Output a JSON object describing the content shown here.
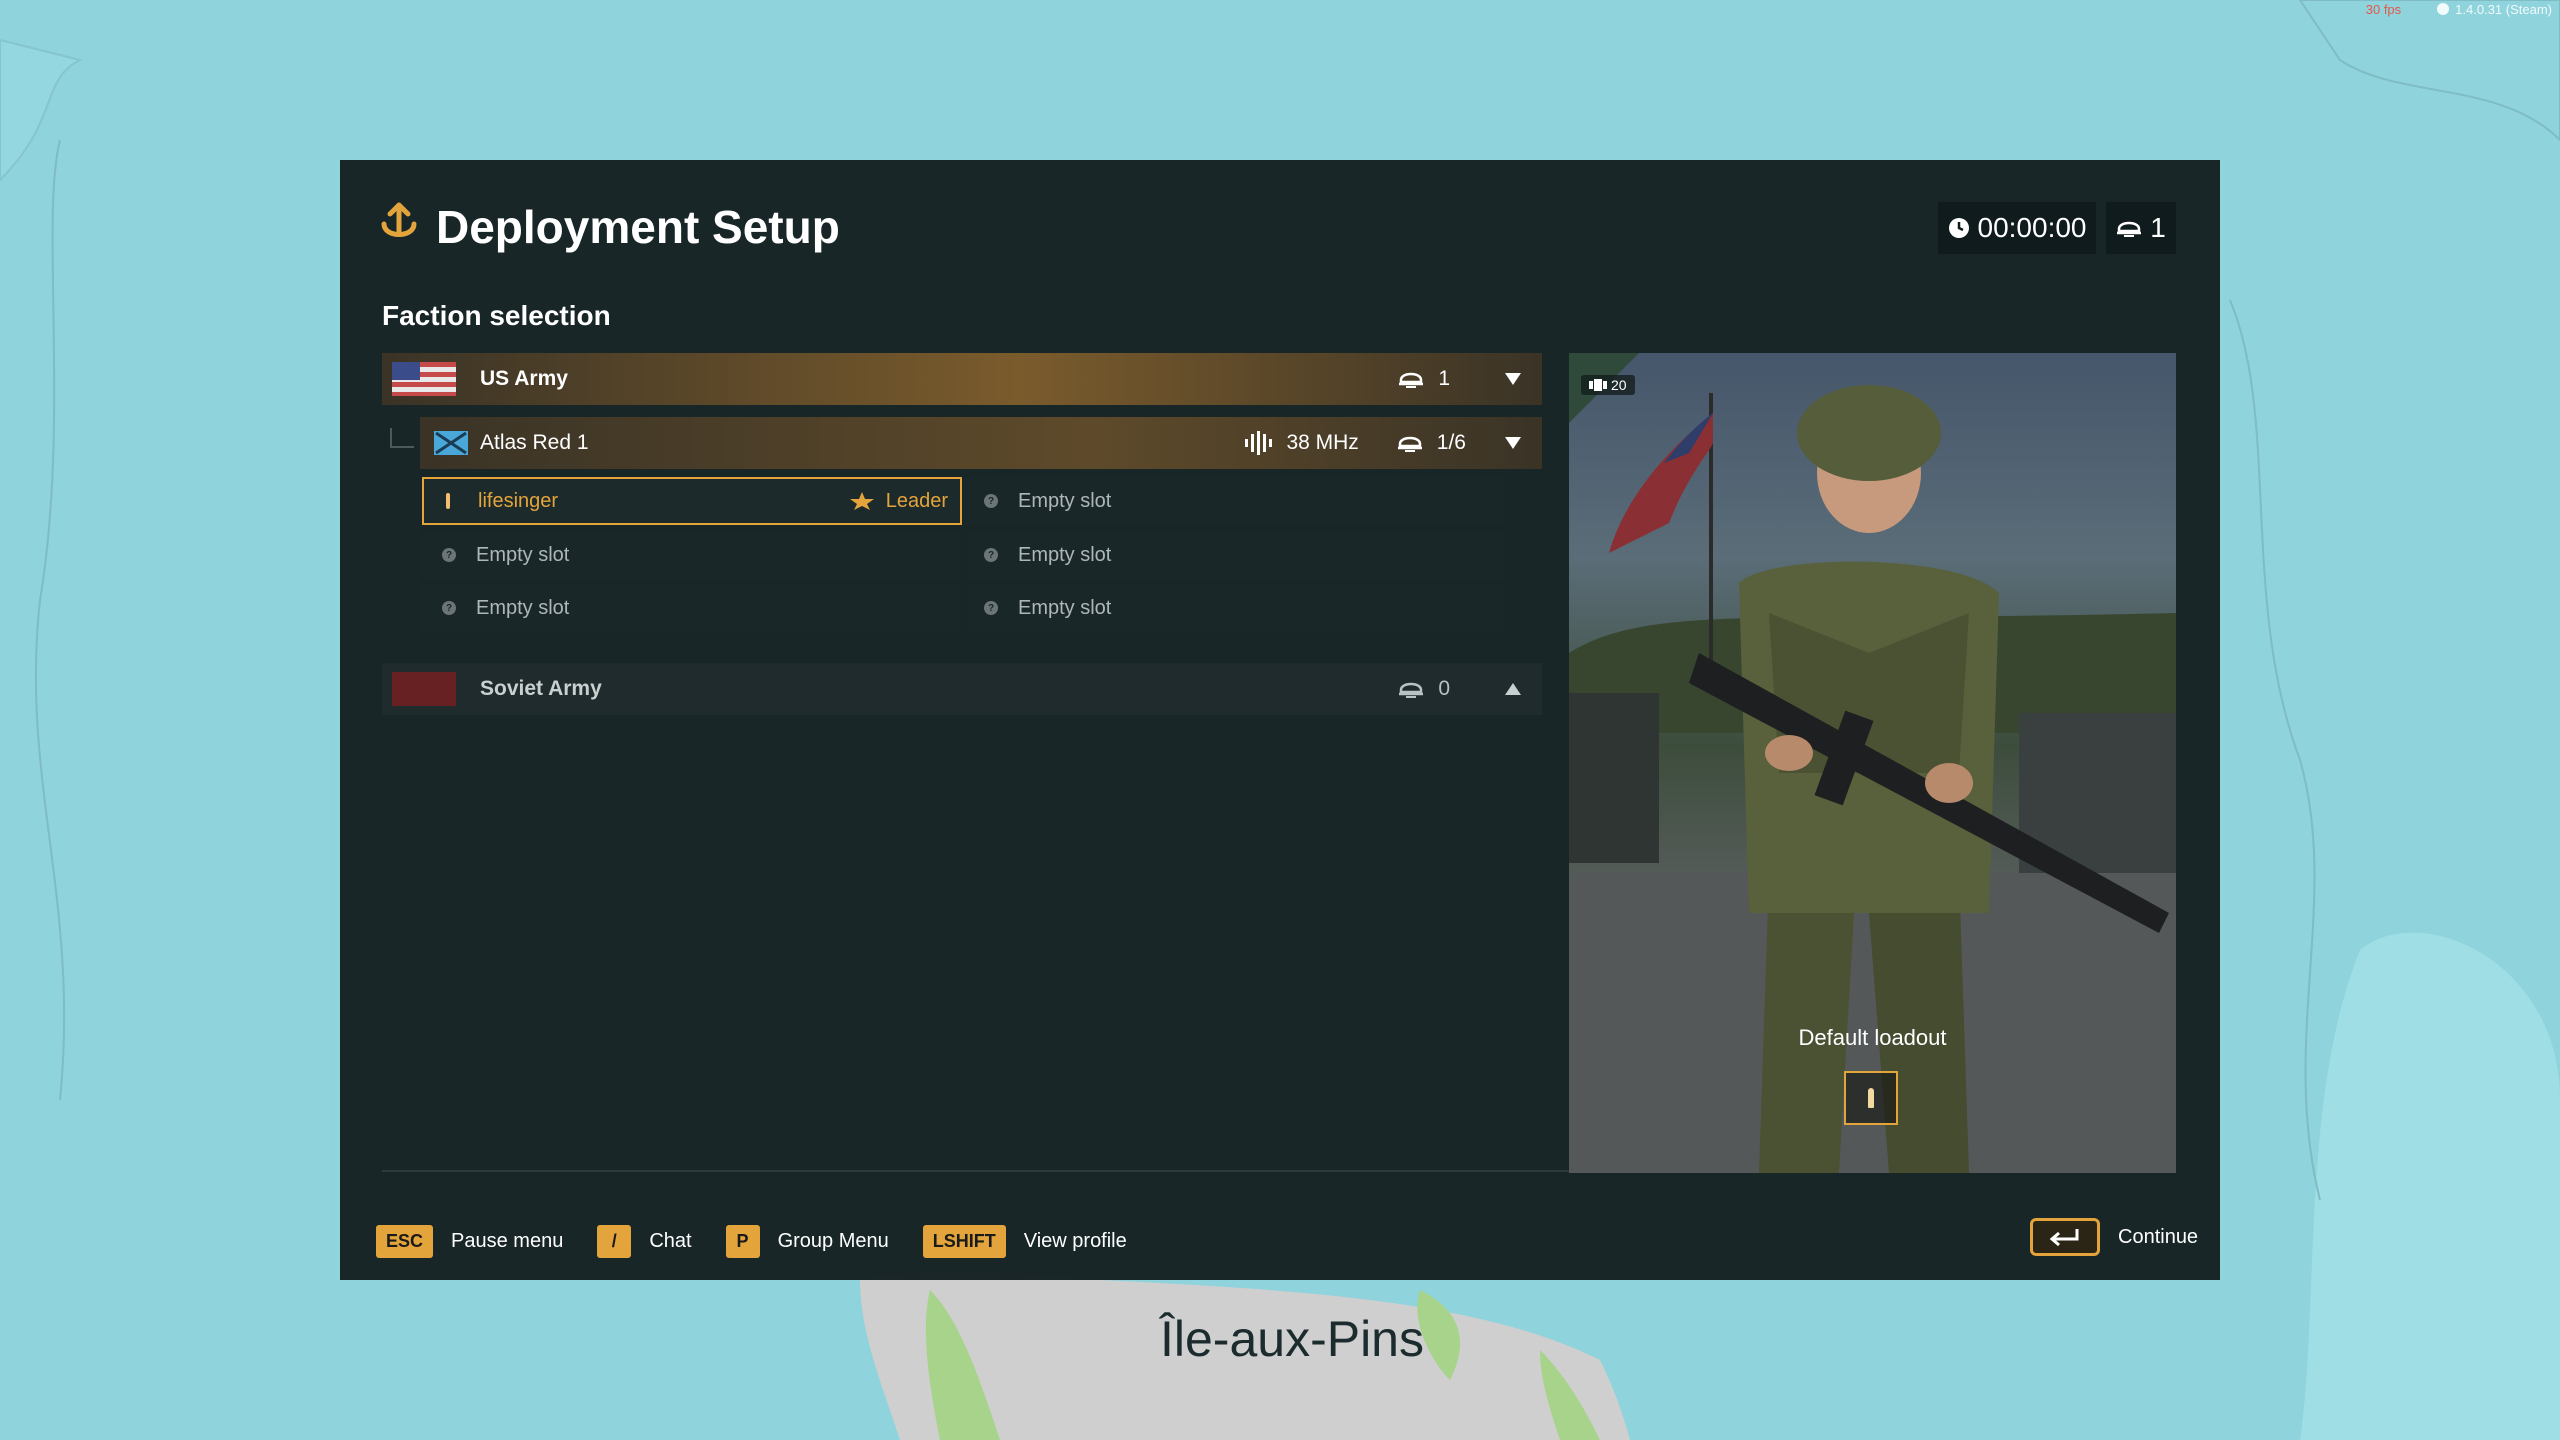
{
  "map": {
    "label": "Île-aux-Pins"
  },
  "status": {
    "fps": "30 fps",
    "version": "1.4.0.31 (Steam)"
  },
  "header": {
    "title": "Deployment Setup",
    "timer": "00:00:00",
    "player_count": "1"
  },
  "faction_section": {
    "title": "Faction selection",
    "factions": [
      {
        "name": "US Army",
        "players": "1"
      },
      {
        "name": "Soviet Army",
        "players": "0"
      }
    ],
    "group": {
      "name": "Atlas Red 1",
      "frequency": "38 MHz",
      "slots_filled": "1/6",
      "slots": [
        {
          "name": "lifesinger",
          "role": "Leader"
        },
        {
          "name": "Empty slot"
        },
        {
          "name": "Empty slot"
        },
        {
          "name": "Empty slot"
        },
        {
          "name": "Empty slot"
        },
        {
          "name": "Empty slot"
        }
      ]
    }
  },
  "preview": {
    "level": "20",
    "loadout_label": "Default loadout"
  },
  "footer": {
    "hints": [
      {
        "key": "ESC",
        "label": "Pause menu"
      },
      {
        "key": "/",
        "label": "Chat"
      },
      {
        "key": "P",
        "label": "Group Menu"
      },
      {
        "key": "LSHIFT",
        "label": "View profile"
      }
    ],
    "continue_label": "Continue"
  },
  "colors": {
    "accent": "#e3a43b",
    "panel": "#142022",
    "map_water": "#8fd3dc"
  }
}
